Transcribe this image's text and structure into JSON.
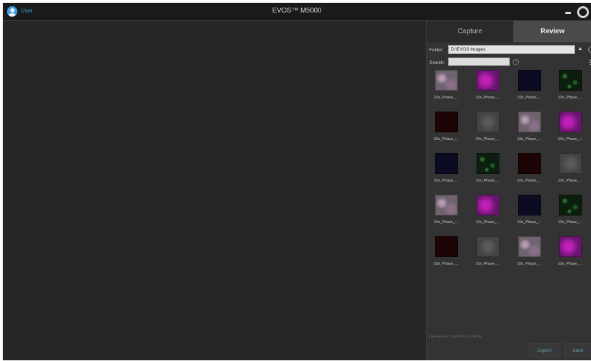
{
  "titlebar": {
    "user_label": "User",
    "app_title": "EVOS™ M5000",
    "icons": [
      "user-icon",
      "minimize-icon",
      "settings-icon"
    ]
  },
  "panel": {
    "tabs": [
      {
        "label": "Capture",
        "active": false
      },
      {
        "label": "Review",
        "active": true
      }
    ],
    "folder_label": "Folder:",
    "folder_value": "D:\\EVOS Images",
    "search_label": "Search:",
    "search_value": "",
    "status": "Free space on: D:\\EVOS\\ 0.1 / 90 GB",
    "export_label": "Export",
    "save_label": "Save"
  },
  "thumbnails": [
    {
      "label": "10x_Phase_...",
      "kind": "phase"
    },
    {
      "label": "10x_Phase_...",
      "kind": "magenta"
    },
    {
      "label": "10x_Phase_...",
      "kind": "blue"
    },
    {
      "label": "10x_Phase_...",
      "kind": "green"
    },
    {
      "label": "10x_Phase_...",
      "kind": "red"
    },
    {
      "label": "10x_Phase_...",
      "kind": "gray"
    },
    {
      "label": "10x_Phase_...",
      "kind": "phase"
    },
    {
      "label": "10x_Phase_...",
      "kind": "magenta"
    },
    {
      "label": "10x_Phase_...",
      "kind": "blue"
    },
    {
      "label": "10x_Phase_...",
      "kind": "green"
    },
    {
      "label": "10x_Phase_...",
      "kind": "red"
    },
    {
      "label": "10x_Phase_...",
      "kind": "gray"
    },
    {
      "label": "10x_Phase_...",
      "kind": "phase"
    },
    {
      "label": "10x_Phase_...",
      "kind": "magenta"
    },
    {
      "label": "10x_Phase_...",
      "kind": "blue"
    },
    {
      "label": "10x_Phase_...",
      "kind": "green"
    },
    {
      "label": "10x_Phase_...",
      "kind": "red"
    },
    {
      "label": "10x_Phase_...",
      "kind": "gray"
    },
    {
      "label": "10x_Phase_...",
      "kind": "phase"
    },
    {
      "label": "10x_Phase_...",
      "kind": "magenta"
    }
  ],
  "colors": {
    "accent": "#3aa0e0",
    "button_text": "#6b8ea6",
    "background": "#262626"
  }
}
